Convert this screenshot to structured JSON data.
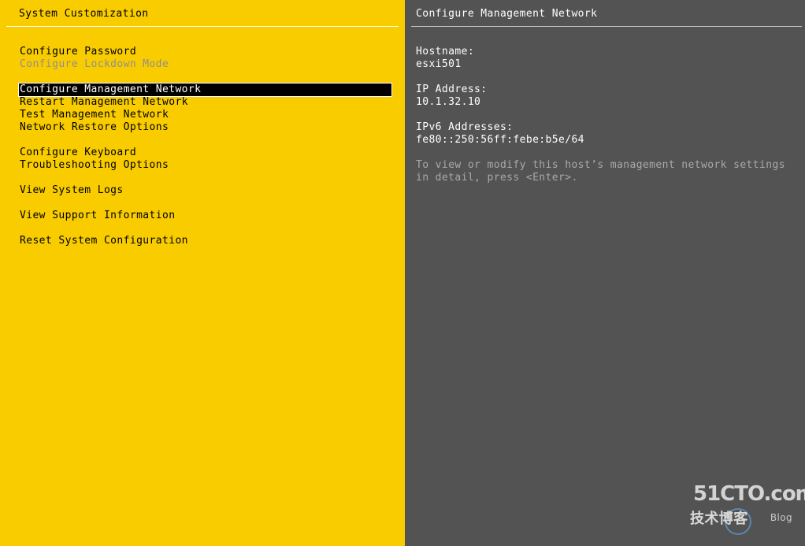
{
  "left_panel": {
    "title": "System Customization",
    "menu_groups": [
      [
        {
          "label": "Configure Password",
          "disabled": false
        },
        {
          "label": "Configure Lockdown Mode",
          "disabled": true
        }
      ],
      [
        {
          "label": "Configure Management Network",
          "selected": true
        },
        {
          "label": "Restart Management Network"
        },
        {
          "label": "Test Management Network"
        },
        {
          "label": "Network Restore Options"
        }
      ],
      [
        {
          "label": "Configure Keyboard"
        },
        {
          "label": "Troubleshooting Options"
        }
      ],
      [
        {
          "label": "View System Logs"
        }
      ],
      [
        {
          "label": "View Support Information"
        }
      ],
      [
        {
          "label": "Reset System Configuration"
        }
      ]
    ]
  },
  "right_panel": {
    "title": "Configure Management Network",
    "hostname_label": "Hostname:",
    "hostname_value": "esxi501",
    "ip_label": "IP Address:",
    "ip_value": "10.1.32.10",
    "ipv6_label": "IPv6 Addresses:",
    "ipv6_value": "fe80::250:56ff:febe:b5e/64",
    "hint": "To view or modify this host’s management network settings in detail, press <Enter>."
  },
  "watermark": {
    "brand": "51CTO.com",
    "sub": "技术博客",
    "blog": "Blog"
  },
  "colors": {
    "left_bg": "#f9cc00",
    "right_bg": "#535353",
    "selected_bg": "#000000",
    "disabled_text": "#8f8f8f",
    "hint_text": "#a9a9a9"
  }
}
